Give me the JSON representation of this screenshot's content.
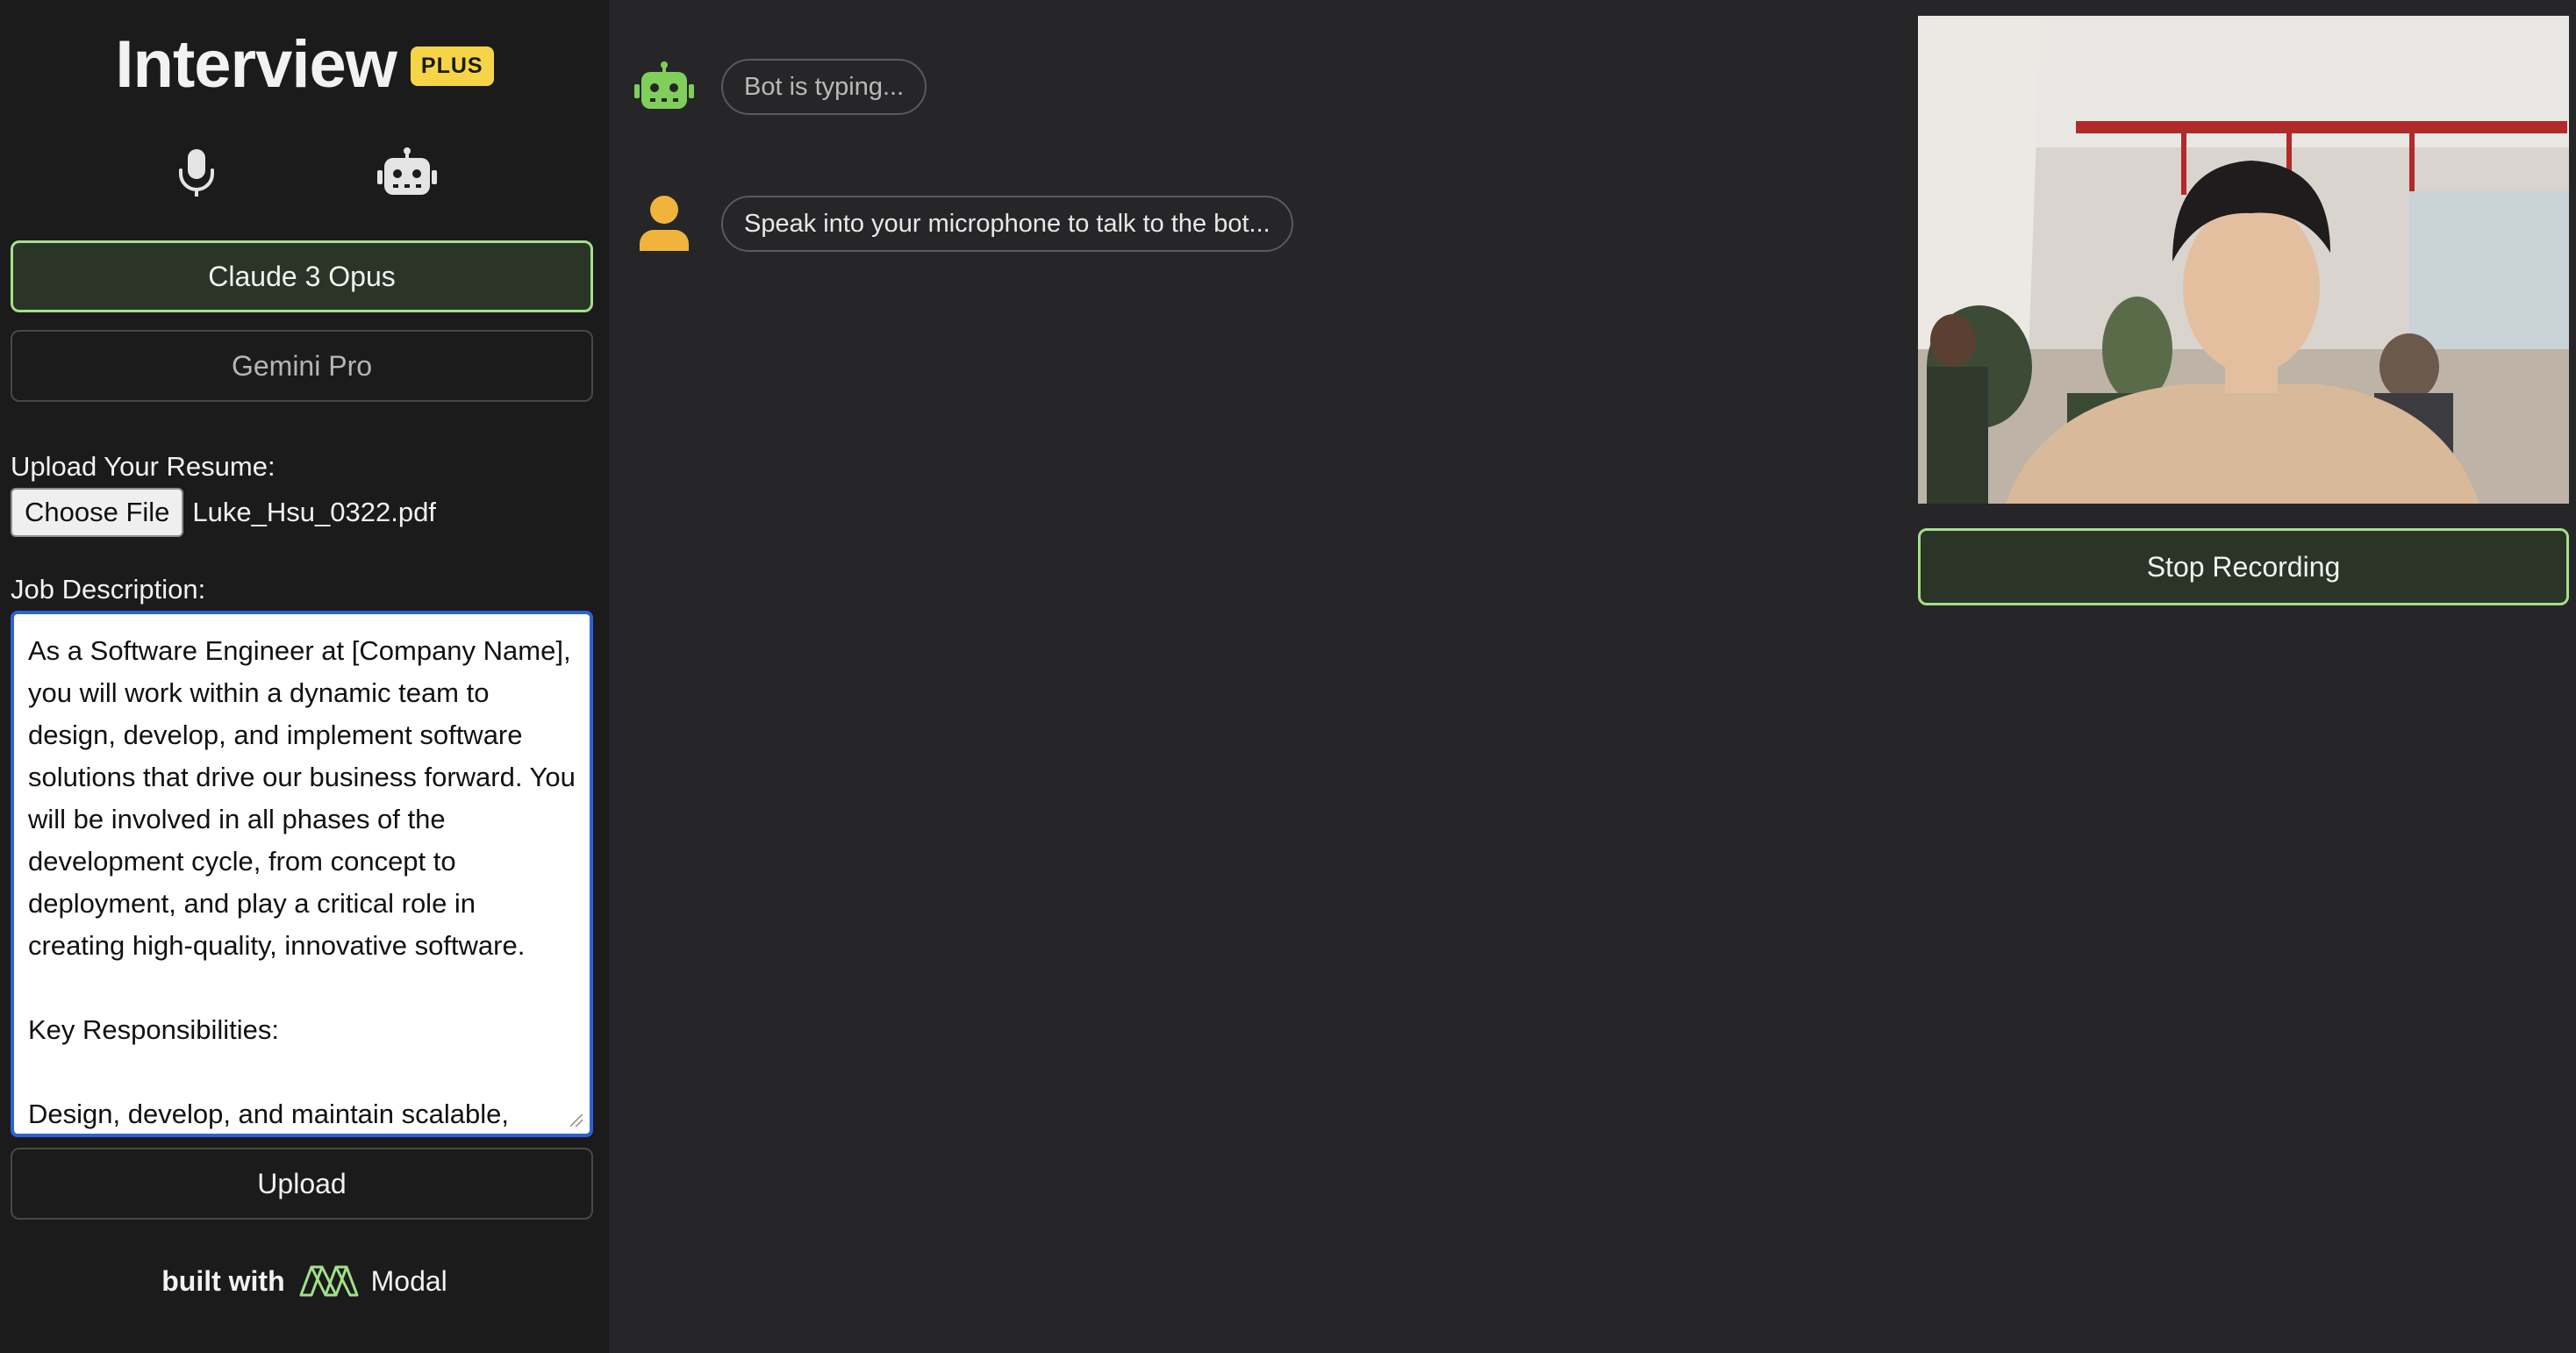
{
  "app": {
    "title": "Interview",
    "badge": "PLUS"
  },
  "modes": {
    "mic_icon": "microphone-icon",
    "bot_icon": "robot-icon"
  },
  "models": {
    "active": "Claude 3 Opus",
    "inactive": "Gemini Pro"
  },
  "resume": {
    "label": "Upload Your Resume:",
    "choose_button": "Choose File",
    "file_name": "Luke_Hsu_0322.pdf"
  },
  "job_description": {
    "label": "Job Description:",
    "text": "As a Software Engineer at [Company Name], you will work within a dynamic team to design, develop, and implement software solutions that drive our business forward. You will be involved in all phases of the development cycle, from concept to deployment, and play a critical role in creating high-quality, innovative software.\n\nKey Responsibilities:\n\nDesign, develop, and maintain scalable,"
  },
  "upload_button": "Upload",
  "footer": {
    "built_with": "built with",
    "brand": "Modal"
  },
  "chat": {
    "bot_message": "Bot is typing...",
    "user_message": "Speak into your microphone to talk to the bot..."
  },
  "video": {
    "stop_button": "Stop Recording"
  },
  "colors": {
    "accent_green": "#a3e089",
    "bot_icon": "#7fcf5a",
    "user_icon": "#f0b43c",
    "badge": "#f5d547",
    "focus_blue": "#2c62d8"
  }
}
